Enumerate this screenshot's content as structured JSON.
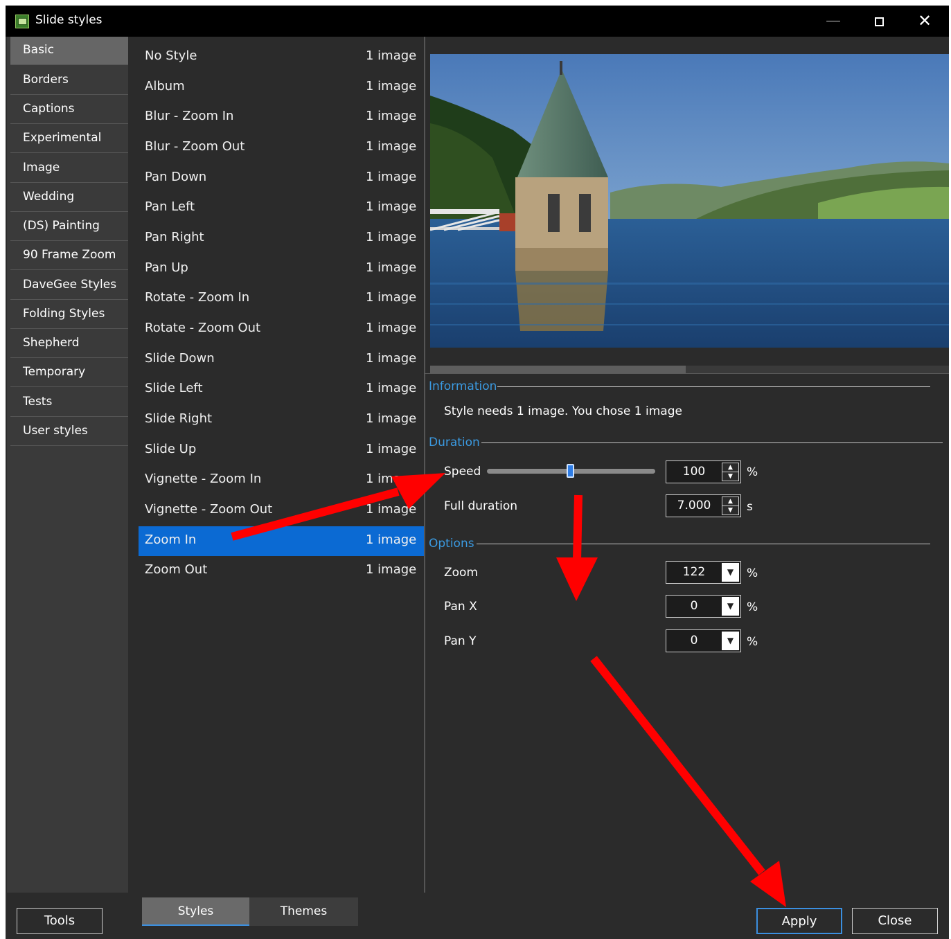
{
  "window": {
    "title": "Slide styles",
    "minimize_glyph": "—",
    "close_glyph": "✕"
  },
  "categories": [
    "Basic",
    "Borders",
    "Captions",
    "Experimental",
    "Image",
    "Wedding",
    "(DS) Painting",
    "90 Frame Zoom",
    "DaveGee Styles",
    "Folding Styles",
    "Shepherd",
    "Temporary",
    "Tests",
    "User styles"
  ],
  "active_category": "Basic",
  "styles": [
    {
      "name": "No Style",
      "count": "1 image"
    },
    {
      "name": "Album",
      "count": "1 image"
    },
    {
      "name": "Blur - Zoom In",
      "count": "1 image"
    },
    {
      "name": "Blur - Zoom Out",
      "count": "1 image"
    },
    {
      "name": "Pan Down",
      "count": "1 image"
    },
    {
      "name": "Pan Left",
      "count": "1 image"
    },
    {
      "name": "Pan Right",
      "count": "1 image"
    },
    {
      "name": "Pan Up",
      "count": "1 image"
    },
    {
      "name": "Rotate - Zoom In",
      "count": "1 image"
    },
    {
      "name": "Rotate - Zoom Out",
      "count": "1 image"
    },
    {
      "name": "Slide Down",
      "count": "1 image"
    },
    {
      "name": "Slide Left",
      "count": "1 image"
    },
    {
      "name": "Slide Right",
      "count": "1 image"
    },
    {
      "name": "Slide Up",
      "count": "1 image"
    },
    {
      "name": "Vignette - Zoom In",
      "count": "1 imag"
    },
    {
      "name": "Vignette - Zoom Out",
      "count": "1 image"
    },
    {
      "name": "Zoom In",
      "count": "1 image"
    },
    {
      "name": "Zoom Out",
      "count": "1 image"
    }
  ],
  "selected_style": "Zoom In",
  "information": {
    "section_label": "Information",
    "text": "Style needs 1 image. You chose 1 image"
  },
  "duration": {
    "section_label": "Duration",
    "speed_label": "Speed",
    "speed_value": "100",
    "speed_unit": "%",
    "speed_slider_fraction": 0.5,
    "full_duration_label": "Full duration",
    "full_duration_value": "7.000",
    "full_duration_unit": "s"
  },
  "options": {
    "section_label": "Options",
    "zoom_label": "Zoom",
    "zoom_value": "122",
    "zoom_unit": "%",
    "pan_x_label": "Pan X",
    "pan_x_value": "0",
    "pan_x_unit": "%",
    "pan_y_label": "Pan Y",
    "pan_y_value": "0",
    "pan_y_unit": "%"
  },
  "bottom": {
    "tools_label": "Tools",
    "tab_styles": "Styles",
    "tab_themes": "Themes",
    "apply_label": "Apply",
    "close_label": "Close"
  },
  "colors": {
    "accent": "#0b6ad3",
    "section_label": "#3b9ae1",
    "annotation_arrow": "#ff0000"
  }
}
